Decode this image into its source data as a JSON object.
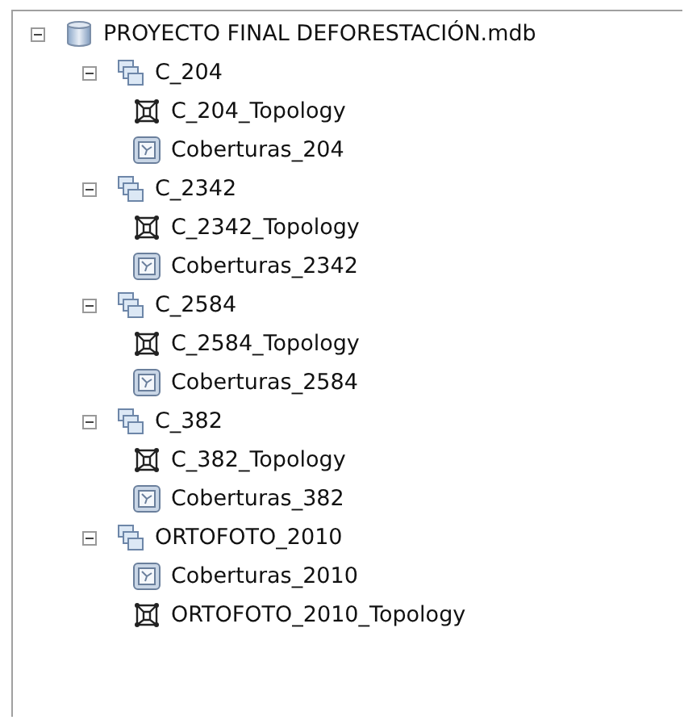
{
  "tree": [
    {
      "label": "PROYECTO FINAL DEFORESTACIÓN.mdb",
      "kind": "database",
      "expanded": true,
      "children": [
        {
          "label": "C_204",
          "kind": "dataset",
          "expanded": true,
          "children": [
            {
              "label": "C_204_Topology",
              "kind": "topology"
            },
            {
              "label": "Coberturas_204",
              "kind": "featureclass"
            }
          ]
        },
        {
          "label": "C_2342",
          "kind": "dataset",
          "expanded": true,
          "children": [
            {
              "label": "C_2342_Topology",
              "kind": "topology"
            },
            {
              "label": "Coberturas_2342",
              "kind": "featureclass"
            }
          ]
        },
        {
          "label": "C_2584",
          "kind": "dataset",
          "expanded": true,
          "children": [
            {
              "label": "C_2584_Topology",
              "kind": "topology"
            },
            {
              "label": "Coberturas_2584",
              "kind": "featureclass"
            }
          ]
        },
        {
          "label": "C_382",
          "kind": "dataset",
          "expanded": true,
          "children": [
            {
              "label": "C_382_Topology",
              "kind": "topology"
            },
            {
              "label": "Coberturas_382",
              "kind": "featureclass"
            }
          ]
        },
        {
          "label": "ORTOFOTO_2010",
          "kind": "dataset",
          "expanded": true,
          "children": [
            {
              "label": "Coberturas_2010",
              "kind": "featureclass"
            },
            {
              "label": "ORTOFOTO_2010_Topology",
              "kind": "topology"
            }
          ]
        }
      ]
    }
  ]
}
